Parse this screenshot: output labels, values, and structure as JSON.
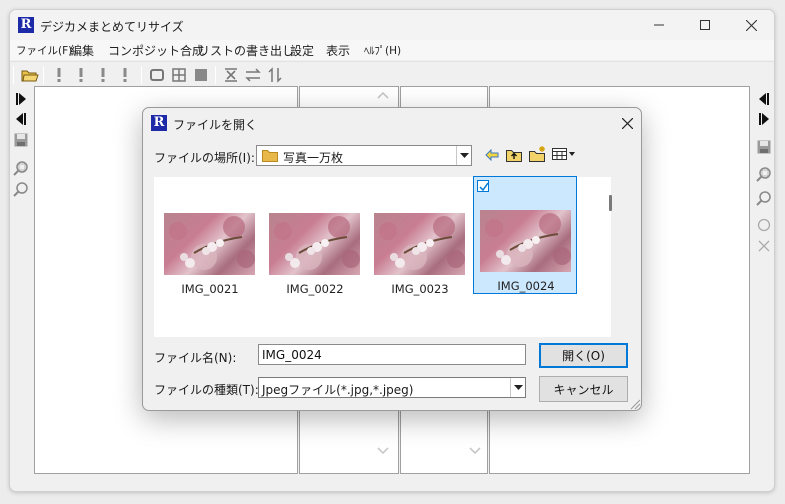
{
  "app": {
    "title": "デジカメまとめてリサイズ",
    "logo_letter": "R",
    "menus": [
      "ファイル(F)",
      "編集",
      "コンポジット合成",
      "リストの書き出し",
      "設定",
      "表示",
      "ﾍﾙﾌﾟ(H)"
    ]
  },
  "dialog": {
    "title": "ファイルを開く",
    "location_label": "ファイルの場所(I):",
    "location_value": "写真一万枚",
    "filename_label": "ファイル名(N):",
    "filename_value": "IMG_0024",
    "filetype_label": "ファイルの種類(T):",
    "filetype_value": "Jpegファイル(*.jpg,*.jpeg)",
    "open_button": "開く(O)",
    "cancel_button": "キャンセル",
    "files": [
      {
        "name": "IMG_0021",
        "selected": false
      },
      {
        "name": "IMG_0022",
        "selected": false
      },
      {
        "name": "IMG_0023",
        "selected": false
      },
      {
        "name": "IMG_0024",
        "selected": true
      }
    ]
  },
  "colors": {
    "accent": "#0078d7",
    "selection": "#cce8ff",
    "logo": "#1c2aa8",
    "folder": "#e8b84a"
  }
}
